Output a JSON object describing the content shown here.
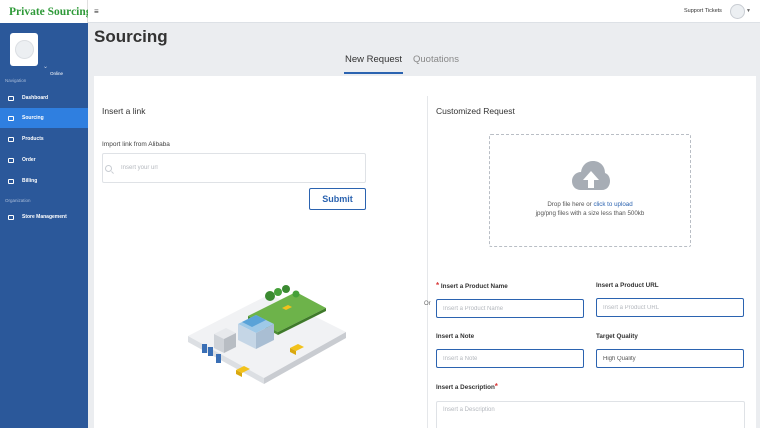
{
  "app": {
    "logo_text": "Private Sourcing"
  },
  "sidebar": {
    "profile_status": "Online",
    "navigation_label": "Navigation",
    "organization_label": "Organization",
    "items": [
      {
        "label": "Dashboard",
        "icon": "home-icon"
      },
      {
        "label": "Sourcing",
        "icon": "list-icon",
        "active": true
      },
      {
        "label": "Products",
        "icon": "box-icon"
      },
      {
        "label": "Order",
        "icon": "bar-chart-icon"
      },
      {
        "label": "Billing",
        "icon": "billing-icon"
      }
    ],
    "org_items": [
      {
        "label": "Store Management",
        "icon": "edit-icon"
      }
    ]
  },
  "header": {
    "support_label": "Support Tickets"
  },
  "page": {
    "title": "Sourcing"
  },
  "tabs": [
    {
      "label": "New Request",
      "active": true
    },
    {
      "label": "Quotations",
      "active": false
    }
  ],
  "link_section": {
    "title": "Insert a link",
    "import_label": "Import link from Alibaba",
    "input_placeholder": "Insert your url",
    "submit_label": "Submit"
  },
  "or_label": "Or",
  "custom_section": {
    "title": "Customized Request",
    "drop_text": "Drop file here or ",
    "drop_link": "click to upload",
    "drop_hint": "jpg/png files with a size less than 500kb",
    "fields": {
      "product_name": {
        "label": "Insert a Product Name",
        "placeholder": "Insert a Product Name",
        "required": true
      },
      "product_url": {
        "label": "Insert a Product URL",
        "placeholder": "Insert a Product URL"
      },
      "note": {
        "label": "Insert a Note",
        "placeholder": "Insert a Note"
      },
      "target_quality": {
        "label": "Target Quality",
        "value": "High Quality"
      },
      "description": {
        "label": "Insert a Description",
        "placeholder": "Insert a Description",
        "required": true
      }
    }
  },
  "colors": {
    "sidebar_bg": "#2b589a",
    "sidebar_active": "#2f7fe0",
    "accent": "#2b63b0",
    "logo_green": "#2f9a39",
    "required": "#d93a3a"
  }
}
